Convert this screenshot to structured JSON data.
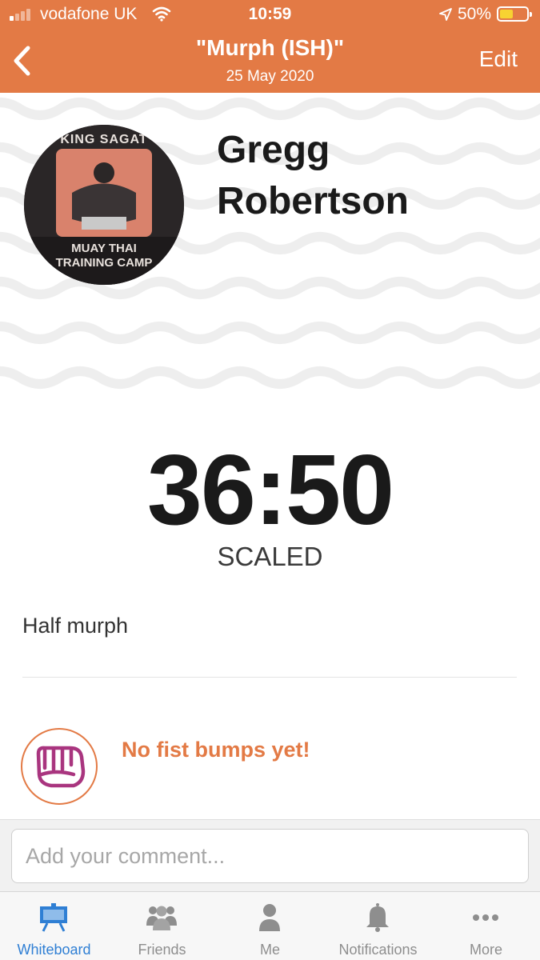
{
  "status_bar": {
    "carrier": "vodafone UK",
    "time": "10:59",
    "battery_percent": "50%",
    "battery_level": 0.5,
    "signal_bars_filled": 1,
    "signal_bars_total": 4
  },
  "nav": {
    "back_icon": "chevron-left-icon",
    "title": "\"Murph (ISH)\"",
    "date": "25 May 2020",
    "edit_label": "Edit"
  },
  "profile": {
    "name": "Gregg Robertson",
    "avatar_text_top": "KING SAGAT",
    "avatar_text_bottom": "MUAY THAI TRAINING CAMP"
  },
  "result": {
    "time": "36:50",
    "scaling": "SCALED",
    "note": "Half murph"
  },
  "fist_bumps": {
    "icon": "fist-icon",
    "empty_label": "No fist bumps yet!"
  },
  "comment": {
    "value": "",
    "placeholder": "Add your comment..."
  },
  "tabs": [
    {
      "label": "Whiteboard",
      "icon": "whiteboard-icon",
      "active": true
    },
    {
      "label": "Friends",
      "icon": "friends-icon",
      "active": false
    },
    {
      "label": "Me",
      "icon": "person-icon",
      "active": false
    },
    {
      "label": "Notifications",
      "icon": "bell-icon",
      "active": false
    },
    {
      "label": "More",
      "icon": "more-dots-icon",
      "active": false
    }
  ],
  "colors": {
    "brand_orange": "#e37a45",
    "active_tab_blue": "#2f7fd4",
    "inactive_tab_gray": "#8e8e8e",
    "battery_yellow": "#f7d232",
    "fist_purple": "#a9357f"
  }
}
